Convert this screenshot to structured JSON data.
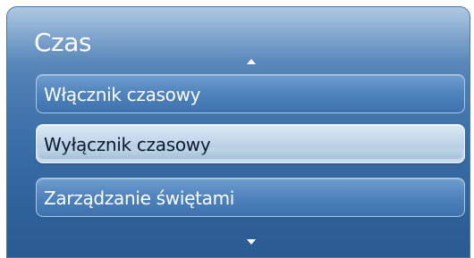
{
  "menu": {
    "title": "Czas",
    "items": [
      {
        "label": "Włącznik czasowy",
        "selected": false
      },
      {
        "label": "Wyłącznik czasowy",
        "selected": true
      },
      {
        "label": "Zarządzanie świętami",
        "selected": false
      }
    ],
    "scroll_up_icon": "triangle-up-icon",
    "scroll_down_icon": "triangle-down-icon"
  },
  "colors": {
    "panel_top": "#8fb2d6",
    "panel_bottom": "#2a5a92",
    "item": "#4f83bd",
    "selected_item": "#c3d7ea",
    "text": "#ffffff",
    "selected_text": "#0b1a2c"
  }
}
